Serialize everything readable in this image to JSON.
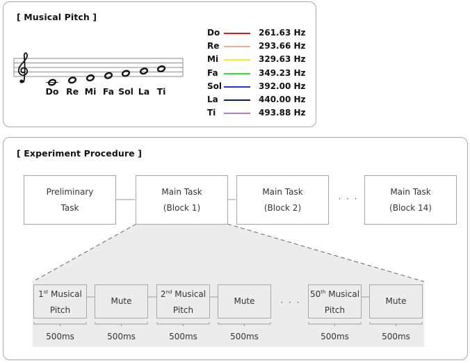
{
  "musical_pitch": {
    "title": "[ Musical Pitch ]",
    "clef_icon": "treble-clef-icon",
    "notes": [
      {
        "name": "Do",
        "frequency": "261.63 Hz",
        "color": "#e0191f"
      },
      {
        "name": "Re",
        "frequency": "293.66 Hz",
        "color": "#f2ac93"
      },
      {
        "name": "Mi",
        "frequency": "329.63 Hz",
        "color": "#f8ee26"
      },
      {
        "name": "Fa",
        "frequency": "349.23 Hz",
        "color": "#2ee52a"
      },
      {
        "name": "Sol",
        "frequency": "392.00 Hz",
        "color": "#1e36d8"
      },
      {
        "name": "La",
        "frequency": "440.00 Hz",
        "color": "#0d1670"
      },
      {
        "name": "Ti",
        "frequency": "493.88 Hz",
        "color": "#b07ac6"
      }
    ]
  },
  "experiment_procedure": {
    "title": "[ Experiment Procedure ]",
    "blocks": [
      {
        "line1": "Preliminary",
        "line2": "Task"
      },
      {
        "line1": "Main Task",
        "line2": "(Block 1)"
      },
      {
        "line1": "Main Task",
        "line2": "(Block 2)"
      },
      {
        "line1": "Main Task",
        "line2": "(Block 14)"
      }
    ],
    "blocks_ellipsis": "· · ·",
    "trial_ellipsis": "· · ·",
    "trial_steps": [
      {
        "num": "1",
        "suffix": "st",
        "line1_rest": " Musical",
        "line2": "Pitch",
        "duration": "500ms"
      },
      {
        "num": "",
        "suffix": "",
        "line1_rest": "Mute",
        "line2": "",
        "duration": "500ms"
      },
      {
        "num": "2",
        "suffix": "nd",
        "line1_rest": " Musical",
        "line2": "Pitch",
        "duration": "500ms"
      },
      {
        "num": "",
        "suffix": "",
        "line1_rest": "Mute",
        "line2": "",
        "duration": "500ms"
      },
      {
        "num": "50",
        "suffix": "th",
        "line1_rest": " Musical",
        "line2": "Pitch",
        "duration": "500ms"
      },
      {
        "num": "",
        "suffix": "",
        "line1_rest": "Mute",
        "line2": "",
        "duration": "500ms"
      }
    ]
  }
}
